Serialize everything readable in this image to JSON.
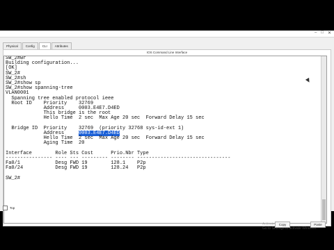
{
  "window": {
    "title": "",
    "tabs": [
      "Physical",
      "Config",
      "CLI",
      "Attributes"
    ],
    "active_tab": "CLI",
    "pane_title": "IOS Command Line Interface"
  },
  "terminal": {
    "lines": [
      "SW_2#wr",
      "Building configuration...",
      "[OK]",
      "SW_2#",
      "SW_2#sh",
      "SW_2#show sp",
      "SW_2#show spanning-tree",
      "VLAN0001",
      "  Spanning tree enabled protocol ieee",
      "  Root ID    Priority    32769",
      "             Address     0003.E4E7.D4ED",
      "             This bridge is the root",
      "             Hello Time  2 sec  Max Age 20 sec  Forward Delay 15 sec",
      "",
      "  Bridge ID  Priority    32769  (priority 32768 sys-id-ext 1)",
      "             Address     ",
      "             Hello Time  2 sec  Max Age 20 sec  Forward Delay 15 sec",
      "             Aging Time  20",
      "",
      "Interface        Role Sts Cost      Prio.Nbr Type",
      "---------------- ---- --- --------- -------- --------------------------------",
      "Fa0/1            Desg FWD 19        128.1    P2p",
      "Fa0/24           Desg FWD 19        128.24   P2p",
      "",
      "SW_2#"
    ],
    "highlighted_address": "0003.E4E7.D4ED"
  },
  "buttons": {
    "copy": "Copy",
    "paste": "Paste"
  },
  "top_checkbox_label": "Top",
  "watermark": [
    "Activate Windows",
    "Go to Settings to activate Windows."
  ]
}
